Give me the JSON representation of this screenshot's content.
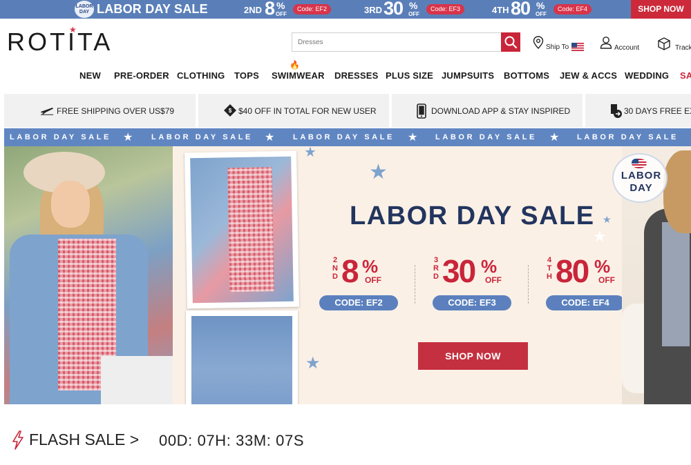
{
  "promo_bar": {
    "badge_text": "LABOR DAY",
    "title": "LABOR DAY SALE",
    "tiers": [
      {
        "ord": "2ND",
        "pct": "8",
        "sym": "%",
        "off": "OFF",
        "code": "Code: EF2"
      },
      {
        "ord": "3RD",
        "pct": "30",
        "sym": "%",
        "off": "OFF",
        "code": "Code: EF3"
      },
      {
        "ord": "4TH",
        "pct": "80",
        "sym": "%",
        "off": "OFF",
        "code": "Code: EF4"
      }
    ],
    "shop_label": "SHOP NOW"
  },
  "header": {
    "logo": "ROTITA",
    "search_placeholder": "Dresses",
    "ship_label": "Ship To",
    "account_label": "Account",
    "track_label": "Track"
  },
  "nav": {
    "items": [
      "NEW",
      "PRE-ORDER",
      "CLOTHING",
      "TOPS",
      "SWIMWEAR",
      "DRESSES",
      "PLUS SIZE",
      "JUMPSUITS",
      "BOTTOMS",
      "JEW & ACCS",
      "WEDDING",
      "SA"
    ]
  },
  "benefits": {
    "items": [
      "FREE SHIPPING OVER US$79",
      "$40 OFF IN TOTAL FOR NEW USER",
      "DOWNLOAD APP & STAY INSPIRED",
      "30 DAYS FREE EXC"
    ]
  },
  "ticker": {
    "text": "LABOR DAY SALE"
  },
  "hero": {
    "title": "LABOR DAY SALE",
    "badge_line1": "LABOR",
    "badge_line2": "DAY",
    "tiers": [
      {
        "ord1": "2",
        "ord2": "N",
        "ord3": "D",
        "pct": "8",
        "sym": "%",
        "off": "OFF",
        "code": "CODE: EF2"
      },
      {
        "ord1": "3",
        "ord2": "R",
        "ord3": "D",
        "pct": "30",
        "sym": "%",
        "off": "OFF",
        "code": "CODE: EF3"
      },
      {
        "ord1": "4",
        "ord2": "T",
        "ord3": "H",
        "pct": "80",
        "sym": "%",
        "off": "OFF",
        "code": "CODE: EF4"
      }
    ],
    "shop_label": "SHOP NOW"
  },
  "flash_sale": {
    "label": "FLASH SALE >",
    "timer": "00D: 07H: 33M: 07S"
  },
  "colors": {
    "promo_blue": "#5a7fb8",
    "accent_red": "#c9253a",
    "navy": "#23355e",
    "code_blue": "#5b80bd"
  }
}
